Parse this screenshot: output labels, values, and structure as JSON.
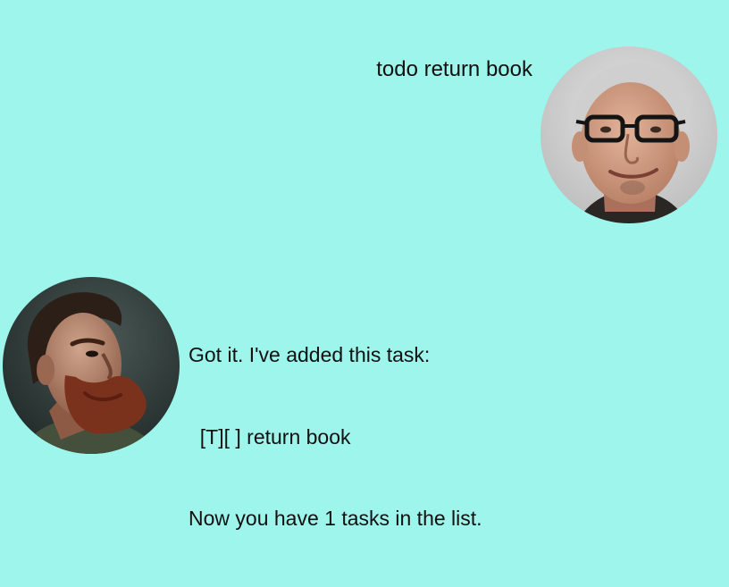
{
  "colors": {
    "background": "#9ef5eb",
    "text": "#111111"
  },
  "user_message": {
    "text": "todo return book",
    "avatar_icon": "user-avatar-photo"
  },
  "bot_message": {
    "lines": [
      "Got it. I've added this task:",
      "  [T][ ] return book",
      "Now you have 1 tasks in the list."
    ],
    "avatar_icon": "bot-avatar-photo"
  }
}
